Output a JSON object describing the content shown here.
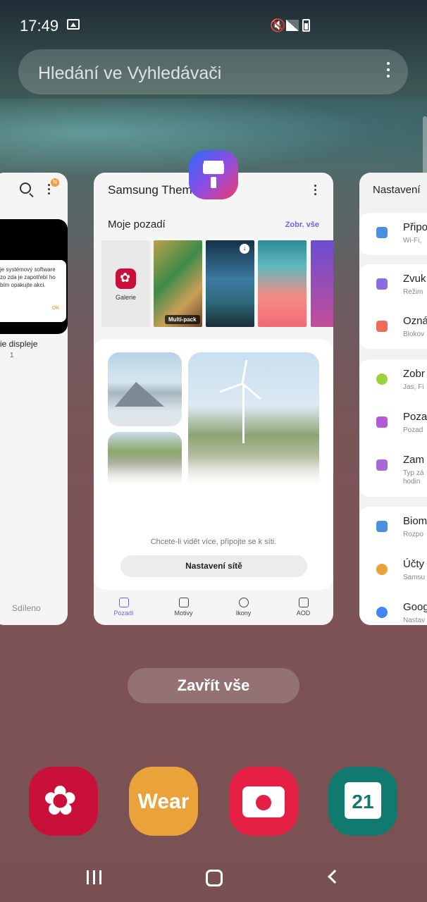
{
  "status": {
    "time": "17:49"
  },
  "search": {
    "placeholder": "Hledání ve Vyhledávači"
  },
  "left_card": {
    "badge": "N",
    "dialog_text": "je systémový software zo zda je zapotřebí ho bím opakujte akci.",
    "dialog_ok": "OK",
    "title": "ie displeje",
    "subtitle": "1",
    "footer": "Sdíleno"
  },
  "middle_card": {
    "app_title": "Samsung Them",
    "section_title": "Moje pozadí",
    "view_all": "Zobr. vše",
    "gallery_label": "Galerie",
    "multipack_label": "Multi-pack",
    "offline_message": "Chcete-li vidět více, připojte se k síti.",
    "network_button": "Nastavení sítě",
    "tabs": [
      {
        "label": "Pozadí",
        "icon": "wallpaper-icon",
        "active": true
      },
      {
        "label": "Motivy",
        "icon": "theme-brush-icon",
        "active": false
      },
      {
        "label": "Ikony",
        "icon": "icons-icon",
        "active": false
      },
      {
        "label": "AOD",
        "icon": "aod-icon",
        "active": false
      }
    ]
  },
  "right_card": {
    "title": "Nastavení",
    "rows": [
      {
        "label": "Připo",
        "sub": "Wi-Fi,",
        "icon": "wifi-icon",
        "color": "#4a8fe0"
      },
      {
        "label": "Zvuk",
        "sub": "Režim",
        "icon": "sound-icon",
        "color": "#8a6de0"
      },
      {
        "label": "Ozná",
        "sub": "Blokov",
        "icon": "notification-icon",
        "color": "#ef6a5b"
      },
      {
        "label": "Zobr",
        "sub": "Jas, Fi",
        "icon": "display-icon",
        "color": "#9bd23c"
      },
      {
        "label": "Poza",
        "sub": "Pozad",
        "icon": "wallpaper-brush-icon",
        "color": "#b45ad8"
      },
      {
        "label": "Zam",
        "sub": "Typ zá hodin",
        "icon": "lock-screen-icon",
        "color": "#a56ad8"
      },
      {
        "label": "Biom",
        "sub": "Rozpo",
        "icon": "shield-icon",
        "color": "#4a8fe0"
      },
      {
        "label": "Účty",
        "sub": "Samsu",
        "icon": "key-icon",
        "color": "#e8a43a"
      },
      {
        "label": "Goog",
        "sub": "Nastav",
        "icon": "google-icon",
        "color": "#4285f4"
      }
    ]
  },
  "close_all": "Zavřít vše",
  "dock": [
    {
      "name": "gallery-app",
      "label": "✿",
      "color": "#c8103a"
    },
    {
      "name": "wear-app",
      "label": "Wear",
      "color": "#eaa33a"
    },
    {
      "name": "screen-recorder-app",
      "label": "",
      "color": "#e51e43"
    },
    {
      "name": "calendar-app",
      "label": "21",
      "color": "#0f7a6d"
    }
  ]
}
